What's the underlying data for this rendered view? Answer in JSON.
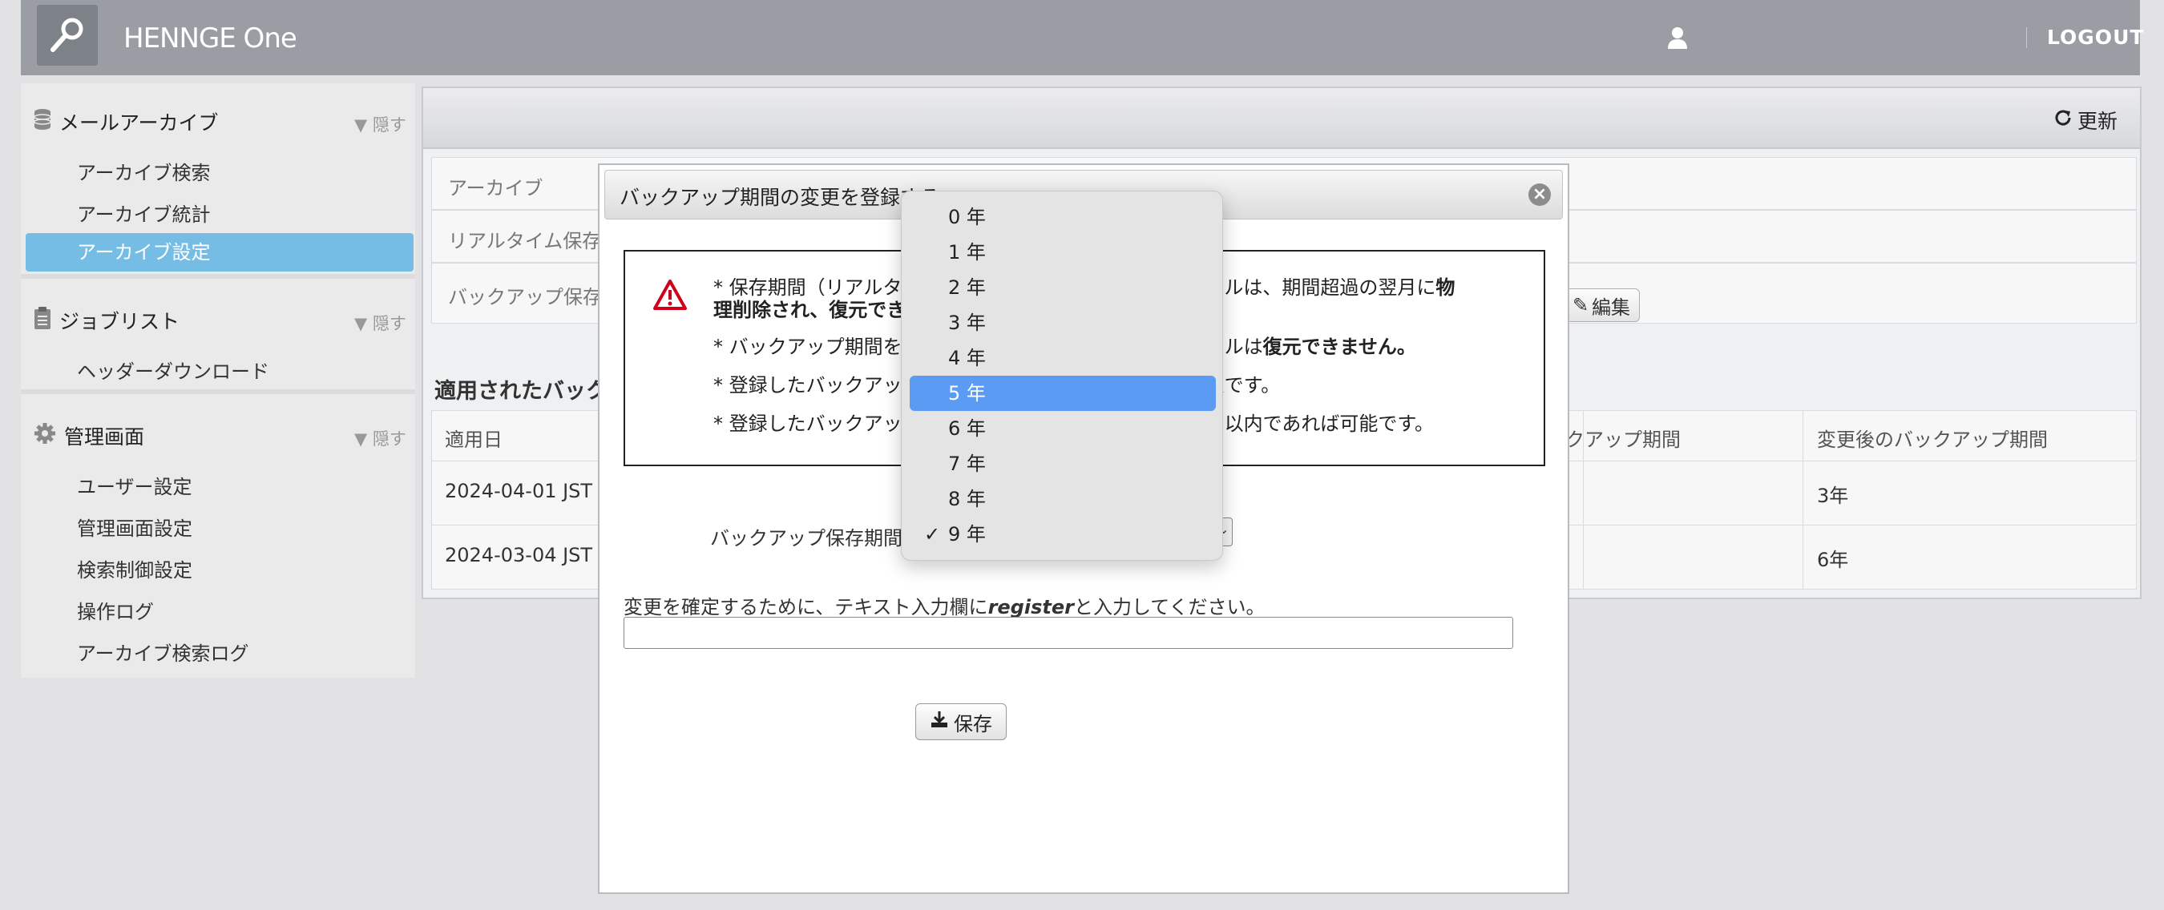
{
  "header": {
    "brand": "HENNGE One",
    "logout": "LOGOUT"
  },
  "sidebar": {
    "sections": [
      {
        "title": "メールアーカイブ",
        "hide": "▼ 隠す",
        "items": [
          "アーカイブ検索",
          "アーカイブ統計",
          "アーカイブ設定"
        ]
      },
      {
        "title": "ジョブリスト",
        "hide": "▼ 隠す",
        "items": [
          "ヘッダーダウンロード"
        ]
      },
      {
        "title": "管理画面",
        "hide": "▼ 隠す",
        "items": [
          "ユーザー設定",
          "管理画面設定",
          "検索制御設定",
          "操作ログ",
          "アーカイブ検索ログ"
        ]
      }
    ],
    "active_item": "アーカイブ設定"
  },
  "main": {
    "refresh": "更新",
    "rows": [
      "アーカイブ",
      "リアルタイム保存期",
      "バックアップ保存期"
    ],
    "edit": "編集",
    "applied_title": "適用されたバック",
    "table": {
      "headers": [
        "適用日",
        "ックアップ期間",
        "変更後のバックアップ期間"
      ],
      "rows": [
        {
          "date": "2024-04-01 JST",
          "after": "3年"
        },
        {
          "date": "2024-03-04 JST",
          "after": "6年"
        }
      ]
    }
  },
  "modal": {
    "title": "バックアップ期間の変更を登録する",
    "warnings": {
      "l1a": "* 保存期間（リアルタ",
      "l1b": "たメールは、期間超過の翌月に",
      "l1c": "物",
      "l2a": "理削除され、復元でき",
      "l3a": "* バックアップ期間を",
      "l3b": "たメールは",
      "l3c": "復元できません。",
      "l4a": "* 登録したバックアッ",
      "l4b": "る予定です。",
      "l5a": "* 登録したバックアッ",
      "l5b": "、当月以内であれば可能です。"
    },
    "backup_label": "バックアップ保存期間",
    "confirm_pre": "変更を確定するために、テキスト入力欄に",
    "confirm_word": "register",
    "confirm_post": "と入力してください。",
    "save": "保存"
  },
  "dropdown": {
    "options": [
      "0 年",
      "1 年",
      "2 年",
      "3 年",
      "4 年",
      "5 年",
      "6 年",
      "7 年",
      "8 年",
      "9 年"
    ],
    "highlighted": "5 年",
    "checked": "9 年",
    "checkmark": "✓"
  },
  "colors": {
    "header": "#9a9ea4",
    "active_item": "#76bde6",
    "highlight": "#5b9bf4",
    "warning": "#d0021b"
  }
}
